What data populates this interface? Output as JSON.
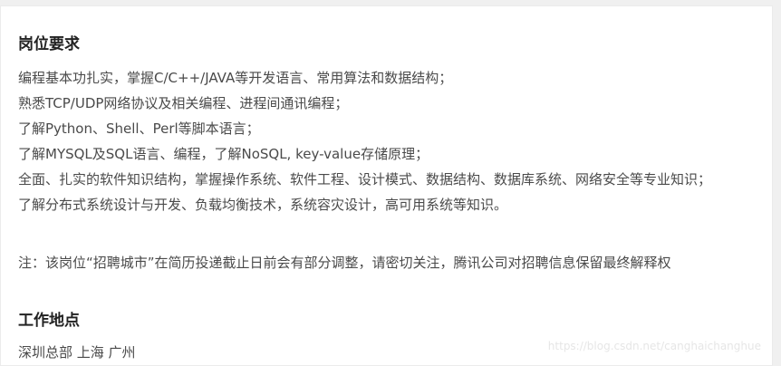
{
  "requirements": {
    "title": "岗位要求",
    "lines": [
      "编程基本功扎实，掌握C/C++/JAVA等开发语言、常用算法和数据结构；",
      "熟悉TCP/UDP网络协议及相关编程、进程间通讯编程；",
      "了解Python、Shell、Perl等脚本语言；",
      "了解MYSQL及SQL语言、编程，了解NoSQL, key-value存储原理；",
      "全面、扎实的软件知识结构，掌握操作系统、软件工程、设计模式、数据结构、数据库系统、网络安全等专业知识；",
      "了解分布式系统设计与开发、负载均衡技术，系统容灾设计，高可用系统等知识。"
    ],
    "note": "注：该岗位“招聘城市”在简历投递截止日前会有部分调整，请密切关注，腾讯公司对招聘信息保留最终解释权"
  },
  "location": {
    "title": "工作地点",
    "value": "深圳总部 上海 广州"
  },
  "watermark": "https://blog.csdn.net/canghaichanghue"
}
